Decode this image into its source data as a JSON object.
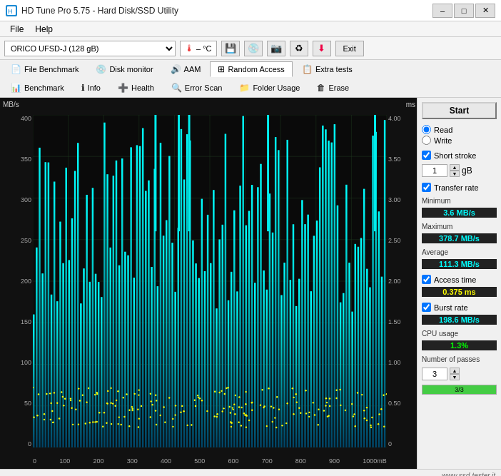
{
  "titleBar": {
    "title": "HD Tune Pro 5.75 - Hard Disk/SSD Utility",
    "minimize": "–",
    "maximize": "□",
    "close": "✕"
  },
  "menuBar": {
    "items": [
      "File",
      "Help"
    ]
  },
  "toolbar": {
    "driveLabel": "ORICO  UFSD-J (128 gB)",
    "temp": "– °C",
    "exitLabel": "Exit"
  },
  "tabs": {
    "row1": [
      {
        "label": "File Benchmark",
        "icon": "📄"
      },
      {
        "label": "Disk monitor",
        "icon": "💿"
      },
      {
        "label": "AAM",
        "icon": "🔊"
      },
      {
        "label": "Random Access",
        "icon": "🔀",
        "active": true
      },
      {
        "label": "Extra tests",
        "icon": "📋"
      }
    ],
    "row2": [
      {
        "label": "Benchmark",
        "icon": "📊"
      },
      {
        "label": "Info",
        "icon": "ℹ"
      },
      {
        "label": "Health",
        "icon": "➕"
      },
      {
        "label": "Error Scan",
        "icon": "🔍"
      },
      {
        "label": "Folder Usage",
        "icon": "📁"
      },
      {
        "label": "Erase",
        "icon": "🗑"
      }
    ]
  },
  "chart": {
    "yLabel": "MB/s",
    "msLabel": "ms",
    "yAxisLeft": [
      "400",
      "350",
      "300",
      "250",
      "200",
      "150",
      "100",
      "50",
      "0"
    ],
    "yAxisRight": [
      "4.00",
      "3.50",
      "3.00",
      "2.50",
      "2.00",
      "1.50",
      "1.00",
      "0.50",
      "0"
    ],
    "xAxisLabels": [
      "0",
      "100",
      "200",
      "300",
      "400",
      "500",
      "600",
      "700",
      "800",
      "900",
      "1000mB"
    ]
  },
  "rightPanel": {
    "startLabel": "Start",
    "readLabel": "Read",
    "writeLabel": "Write",
    "shortStrokeLabel": "Short stroke",
    "shortStrokeValue": "1",
    "shortStrokeUnit": "gB",
    "transferRateLabel": "Transfer rate",
    "minimumLabel": "Minimum",
    "minimumValue": "3.6 MB/s",
    "maximumLabel": "Maximum",
    "maximumValue": "378.7 MB/s",
    "averageLabel": "Average",
    "averageValue": "111.3 MB/s",
    "accessTimeLabel": "Access time",
    "accessTimeValue": "0.375 ms",
    "burstRateLabel": "Burst rate",
    "burstRateValue": "198.6 MB/s",
    "cpuUsageLabel": "CPU usage",
    "cpuUsageValue": "1.3%",
    "passesLabel": "Number of passes",
    "passesValue": "3",
    "progressText": "3/3",
    "progressPercent": 100
  },
  "statusBar": {
    "watermark": "www.ssd-tester.it"
  }
}
